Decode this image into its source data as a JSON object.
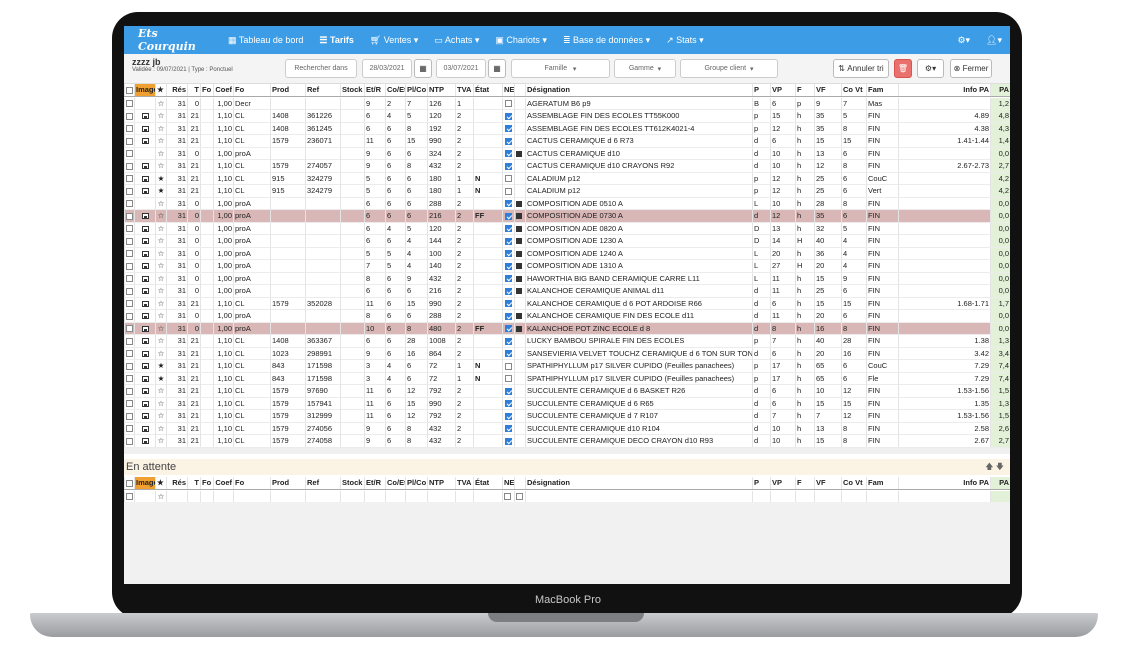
{
  "device_label": "MacBook Pro",
  "nav": {
    "brand": "Ets Courquin",
    "items": [
      "Tableau de bord",
      "Tarifs",
      "Ventes",
      "Achats",
      "Chariots",
      "Base de données",
      "Stats"
    ]
  },
  "toolbar": {
    "title": "zzzz jb",
    "subtitle": "Validée : 09/07/2021 | Type : Ponctuel",
    "search_placeholder": "Rechercher dans",
    "date_from": "28/03/2021",
    "date_to": "03/07/2021",
    "famille_placeholder": "Famille",
    "gamme_placeholder": "Gamme",
    "groupe_placeholder": "Groupe client",
    "annuler_tri": "Annuler tri",
    "fermer": "Fermer"
  },
  "columns": [
    "Ch",
    "Image",
    "★",
    "Rés",
    "T",
    "Fo",
    "Coef",
    "Fo",
    "Prod",
    "Ref",
    "Stock",
    "Et/R",
    "Co/Et",
    "Pl/Co",
    "NTP",
    "TVA",
    "État",
    "NE",
    "Co",
    "Désignation",
    "P",
    "VP",
    "F",
    "VF",
    "Co",
    "Vt",
    "Fam",
    "Info PA",
    "PA"
  ],
  "header_labels": {
    "img": "Image",
    "star": "★",
    "res": "Rés",
    "t": "T",
    "fo": "Fo",
    "coef": "Coef",
    "fo2": "Fo",
    "prod": "Prod",
    "ref": "Ref",
    "stock": "Stock",
    "etr": "Et/R",
    "coet": "Co/Et",
    "plco": "Pl/Co",
    "ntp": "NTP",
    "tva": "TVA",
    "etat": "État",
    "neco": "NECo",
    "des": "Désignation",
    "p": "P",
    "vp": "VP",
    "f": "F",
    "vf": "VF",
    "covt": "Co Vt",
    "fam": "Fam",
    "infopa": "Info PA",
    "pa": "PA"
  },
  "rows": [
    {
      "img": false,
      "star": false,
      "res": "31",
      "t": "0",
      "coef": "1,00",
      "fo": "Decr",
      "prod": "",
      "ref": "",
      "stock": "",
      "etr": "9",
      "coet": "2",
      "plco": "7",
      "ntp": "126",
      "tva": "1",
      "etat": "",
      "ne": false,
      "co": false,
      "des": "AGERATUM B6 p9",
      "p": "B",
      "vp": "6",
      "f": "p",
      "vf": "9",
      "covt": "7",
      "fam": "Mas",
      "info": "",
      "pa": "1,2",
      "pink": false
    },
    {
      "img": true,
      "star": false,
      "res": "31",
      "t": "21",
      "coef": "1,10",
      "fo": "CL",
      "prod": "1408",
      "ref": "361226",
      "stock": "",
      "etr": "6",
      "coet": "4",
      "plco": "5",
      "ntp": "120",
      "tva": "2",
      "etat": "",
      "ne": true,
      "co": false,
      "des": "ASSEMBLAGE FIN DES ECOLES TT55K000",
      "p": "p",
      "vp": "15",
      "f": "h",
      "vf": "35",
      "covt": "5",
      "fam": "FIN",
      "info": "4.89",
      "pa": "4,8",
      "pink": false
    },
    {
      "img": true,
      "star": false,
      "res": "31",
      "t": "21",
      "coef": "1,10",
      "fo": "CL",
      "prod": "1408",
      "ref": "361245",
      "stock": "",
      "etr": "6",
      "coet": "6",
      "plco": "8",
      "ntp": "192",
      "tva": "2",
      "etat": "",
      "ne": true,
      "co": false,
      "des": "ASSEMBLAGE FIN DES ECOLES TT612K4021-4",
      "p": "p",
      "vp": "12",
      "f": "h",
      "vf": "35",
      "covt": "8",
      "fam": "FIN",
      "info": "4.38",
      "pa": "4,3",
      "pink": false
    },
    {
      "img": true,
      "star": false,
      "res": "31",
      "t": "21",
      "coef": "1,10",
      "fo": "CL",
      "prod": "1579",
      "ref": "236071",
      "stock": "",
      "etr": "11",
      "coet": "6",
      "plco": "15",
      "ntp": "990",
      "tva": "2",
      "etat": "",
      "ne": true,
      "co": false,
      "des": "CACTUS CERAMIQUE d 6 R73",
      "p": "d",
      "vp": "6",
      "f": "h",
      "vf": "15",
      "covt": "15",
      "fam": "FIN",
      "info": "1.41-1.44",
      "pa": "1,4",
      "pink": false
    },
    {
      "img": false,
      "star": false,
      "res": "31",
      "t": "0",
      "coef": "1,00",
      "fo": "proA",
      "prod": "",
      "ref": "",
      "stock": "",
      "etr": "9",
      "coet": "6",
      "plco": "6",
      "ntp": "324",
      "tva": "2",
      "etat": "",
      "ne": true,
      "co": true,
      "des": "CACTUS CERAMIQUE d10",
      "p": "d",
      "vp": "10",
      "f": "h",
      "vf": "13",
      "covt": "6",
      "fam": "FIN",
      "info": "",
      "pa": "0,0",
      "pink": false
    },
    {
      "img": true,
      "star": false,
      "res": "31",
      "t": "21",
      "coef": "1,10",
      "fo": "CL",
      "prod": "1579",
      "ref": "274057",
      "stock": "",
      "etr": "9",
      "coet": "6",
      "plco": "8",
      "ntp": "432",
      "tva": "2",
      "etat": "",
      "ne": true,
      "co": false,
      "des": "CACTUS CERAMIQUE d10 CRAYONS R92",
      "p": "d",
      "vp": "10",
      "f": "h",
      "vf": "12",
      "covt": "8",
      "fam": "FIN",
      "info": "2.67-2.73",
      "pa": "2,7",
      "pink": false
    },
    {
      "img": true,
      "star": true,
      "res": "31",
      "t": "21",
      "coef": "1,10",
      "fo": "CL",
      "prod": "915",
      "ref": "324279",
      "stock": "",
      "etr": "5",
      "coet": "6",
      "plco": "6",
      "ntp": "180",
      "tva": "1",
      "etat": "N",
      "ne": false,
      "co": false,
      "des": "CALADIUM p12",
      "p": "p",
      "vp": "12",
      "f": "h",
      "vf": "25",
      "covt": "6",
      "fam": "CouC",
      "info": "",
      "pa": "4,2",
      "pink": false
    },
    {
      "img": true,
      "star": true,
      "res": "31",
      "t": "21",
      "coef": "1,10",
      "fo": "CL",
      "prod": "915",
      "ref": "324279",
      "stock": "",
      "etr": "5",
      "coet": "6",
      "plco": "6",
      "ntp": "180",
      "tva": "1",
      "etat": "N",
      "ne": false,
      "co": false,
      "des": "CALADIUM p12",
      "p": "p",
      "vp": "12",
      "f": "h",
      "vf": "25",
      "covt": "6",
      "fam": "Vert",
      "info": "",
      "pa": "4,2",
      "pink": false
    },
    {
      "img": false,
      "star": false,
      "res": "31",
      "t": "0",
      "coef": "1,00",
      "fo": "proA",
      "prod": "",
      "ref": "",
      "stock": "",
      "etr": "6",
      "coet": "6",
      "plco": "6",
      "ntp": "288",
      "tva": "2",
      "etat": "",
      "ne": true,
      "co": true,
      "des": "COMPOSITION ADE 0510 A",
      "p": "L",
      "vp": "10",
      "f": "h",
      "vf": "28",
      "covt": "8",
      "fam": "FIN",
      "info": "",
      "pa": "0,0",
      "pink": false
    },
    {
      "img": true,
      "star": false,
      "res": "31",
      "t": "0",
      "coef": "1,00",
      "fo": "proA",
      "prod": "",
      "ref": "",
      "stock": "",
      "etr": "6",
      "coet": "6",
      "plco": "6",
      "ntp": "216",
      "tva": "2",
      "etat": "FF",
      "ne": true,
      "co": true,
      "des": "COMPOSITION ADE 0730 A",
      "p": "d",
      "vp": "12",
      "f": "h",
      "vf": "35",
      "covt": "6",
      "fam": "FIN",
      "info": "",
      "pa": "0,0",
      "pink": true
    },
    {
      "img": true,
      "star": false,
      "res": "31",
      "t": "0",
      "coef": "1,00",
      "fo": "proA",
      "prod": "",
      "ref": "",
      "stock": "",
      "etr": "6",
      "coet": "4",
      "plco": "5",
      "ntp": "120",
      "tva": "2",
      "etat": "",
      "ne": true,
      "co": true,
      "des": "COMPOSITION ADE 0820 A",
      "p": "D",
      "vp": "13",
      "f": "h",
      "vf": "32",
      "covt": "5",
      "fam": "FIN",
      "info": "",
      "pa": "0,0",
      "pink": false
    },
    {
      "img": true,
      "star": false,
      "res": "31",
      "t": "0",
      "coef": "1,00",
      "fo": "proA",
      "prod": "",
      "ref": "",
      "stock": "",
      "etr": "6",
      "coet": "6",
      "plco": "4",
      "ntp": "144",
      "tva": "2",
      "etat": "",
      "ne": true,
      "co": true,
      "des": "COMPOSITION ADE 1230 A",
      "p": "D",
      "vp": "14",
      "f": "H",
      "vf": "40",
      "covt": "4",
      "fam": "FIN",
      "info": "",
      "pa": "0,0",
      "pink": false
    },
    {
      "img": true,
      "star": false,
      "res": "31",
      "t": "0",
      "coef": "1,00",
      "fo": "proA",
      "prod": "",
      "ref": "",
      "stock": "",
      "etr": "5",
      "coet": "5",
      "plco": "4",
      "ntp": "100",
      "tva": "2",
      "etat": "",
      "ne": true,
      "co": true,
      "des": "COMPOSITION ADE 1240 A",
      "p": "L",
      "vp": "20",
      "f": "h",
      "vf": "36",
      "covt": "4",
      "fam": "FIN",
      "info": "",
      "pa": "0,0",
      "pink": false
    },
    {
      "img": true,
      "star": false,
      "res": "31",
      "t": "0",
      "coef": "1,00",
      "fo": "proA",
      "prod": "",
      "ref": "",
      "stock": "",
      "etr": "7",
      "coet": "5",
      "plco": "4",
      "ntp": "140",
      "tva": "2",
      "etat": "",
      "ne": true,
      "co": true,
      "des": "COMPOSITION ADE 1310 A",
      "p": "L",
      "vp": "27",
      "f": "H",
      "vf": "20",
      "covt": "4",
      "fam": "FIN",
      "info": "",
      "pa": "0,0",
      "pink": false
    },
    {
      "img": true,
      "star": false,
      "res": "31",
      "t": "0",
      "coef": "1,00",
      "fo": "proA",
      "prod": "",
      "ref": "",
      "stock": "",
      "etr": "8",
      "coet": "6",
      "plco": "9",
      "ntp": "432",
      "tva": "2",
      "etat": "",
      "ne": true,
      "co": true,
      "des": "HAWORTHIA BIG BAND CERAMIQUE CARRE L11",
      "p": "L",
      "vp": "11",
      "f": "h",
      "vf": "15",
      "covt": "9",
      "fam": "FIN",
      "info": "",
      "pa": "0,0",
      "pink": false
    },
    {
      "img": true,
      "star": false,
      "res": "31",
      "t": "0",
      "coef": "1,00",
      "fo": "proA",
      "prod": "",
      "ref": "",
      "stock": "",
      "etr": "6",
      "coet": "6",
      "plco": "6",
      "ntp": "216",
      "tva": "2",
      "etat": "",
      "ne": true,
      "co": true,
      "des": "KALANCHOE CERAMIQUE ANIMAL d11",
      "p": "d",
      "vp": "11",
      "f": "h",
      "vf": "25",
      "covt": "6",
      "fam": "FIN",
      "info": "",
      "pa": "0,0",
      "pink": false
    },
    {
      "img": true,
      "star": false,
      "res": "31",
      "t": "21",
      "coef": "1,10",
      "fo": "CL",
      "prod": "1579",
      "ref": "352028",
      "stock": "",
      "etr": "11",
      "coet": "6",
      "plco": "15",
      "ntp": "990",
      "tva": "2",
      "etat": "",
      "ne": true,
      "co": false,
      "des": "KALANCHOE CERAMIQUE d 6 POT ARDOISE R66",
      "p": "d",
      "vp": "6",
      "f": "h",
      "vf": "15",
      "covt": "15",
      "fam": "FIN",
      "info": "1.68-1.71",
      "pa": "1,7",
      "pink": false
    },
    {
      "img": true,
      "star": false,
      "res": "31",
      "t": "0",
      "coef": "1,00",
      "fo": "proA",
      "prod": "",
      "ref": "",
      "stock": "",
      "etr": "8",
      "coet": "6",
      "plco": "6",
      "ntp": "288",
      "tva": "2",
      "etat": "",
      "ne": true,
      "co": true,
      "des": "KALANCHOE CERAMIQUE FIN DES ECOLE d11",
      "p": "d",
      "vp": "11",
      "f": "h",
      "vf": "20",
      "covt": "6",
      "fam": "FIN",
      "info": "",
      "pa": "0,0",
      "pink": false
    },
    {
      "img": true,
      "star": false,
      "res": "31",
      "t": "0",
      "coef": "1,00",
      "fo": "proA",
      "prod": "",
      "ref": "",
      "stock": "",
      "etr": "10",
      "coet": "6",
      "plco": "8",
      "ntp": "480",
      "tva": "2",
      "etat": "FF",
      "ne": true,
      "co": true,
      "des": "KALANCHOE POT ZINC ECOLE d 8",
      "p": "d",
      "vp": "8",
      "f": "h",
      "vf": "16",
      "covt": "8",
      "fam": "FIN",
      "info": "",
      "pa": "0,0",
      "pink": true
    },
    {
      "img": true,
      "star": false,
      "res": "31",
      "t": "21",
      "coef": "1,10",
      "fo": "CL",
      "prod": "1408",
      "ref": "363367",
      "stock": "",
      "etr": "6",
      "coet": "6",
      "plco": "28",
      "ntp": "1008",
      "tva": "2",
      "etat": "",
      "ne": true,
      "co": false,
      "des": "LUCKY BAMBOU SPIRALE FIN DES ECOLES",
      "p": "p",
      "vp": "7",
      "f": "h",
      "vf": "40",
      "covt": "28",
      "fam": "FIN",
      "info": "1.38",
      "pa": "1,3",
      "pink": false
    },
    {
      "img": true,
      "star": false,
      "res": "31",
      "t": "21",
      "coef": "1,10",
      "fo": "CL",
      "prod": "1023",
      "ref": "298991",
      "stock": "",
      "etr": "9",
      "coet": "6",
      "plco": "16",
      "ntp": "864",
      "tva": "2",
      "etat": "",
      "ne": true,
      "co": false,
      "des": "SANSEVIERIA VELVET TOUCHZ CERAMIQUE d 6 TON SUR TON",
      "p": "d",
      "vp": "6",
      "f": "h",
      "vf": "20",
      "covt": "16",
      "fam": "FIN",
      "info": "3.42",
      "pa": "3,4",
      "pink": false
    },
    {
      "img": true,
      "star": true,
      "res": "31",
      "t": "21",
      "coef": "1,10",
      "fo": "CL",
      "prod": "843",
      "ref": "171598",
      "stock": "",
      "etr": "3",
      "coet": "4",
      "plco": "6",
      "ntp": "72",
      "tva": "1",
      "etat": "N",
      "ne": false,
      "co": false,
      "des": "SPATHIPHYLLUM p17 SILVER CUPIDO (Feuilles panachees)",
      "p": "p",
      "vp": "17",
      "f": "h",
      "vf": "65",
      "covt": "6",
      "fam": "CouC",
      "info": "7.29",
      "pa": "7,4",
      "pink": false
    },
    {
      "img": true,
      "star": true,
      "res": "31",
      "t": "21",
      "coef": "1,10",
      "fo": "CL",
      "prod": "843",
      "ref": "171598",
      "stock": "",
      "etr": "3",
      "coet": "4",
      "plco": "6",
      "ntp": "72",
      "tva": "1",
      "etat": "N",
      "ne": false,
      "co": false,
      "des": "SPATHIPHYLLUM p17 SILVER CUPIDO (Feuilles panachees)",
      "p": "p",
      "vp": "17",
      "f": "h",
      "vf": "65",
      "covt": "6",
      "fam": "Fle",
      "info": "7.29",
      "pa": "7,4",
      "pink": false
    },
    {
      "img": true,
      "star": false,
      "res": "31",
      "t": "21",
      "coef": "1,10",
      "fo": "CL",
      "prod": "1579",
      "ref": "97690",
      "stock": "",
      "etr": "11",
      "coet": "6",
      "plco": "12",
      "ntp": "792",
      "tva": "2",
      "etat": "",
      "ne": true,
      "co": false,
      "des": "SUCCULENTE CERAMIQUE d 6 BASKET R26",
      "p": "d",
      "vp": "6",
      "f": "h",
      "vf": "10",
      "covt": "12",
      "fam": "FIN",
      "info": "1.53-1.56",
      "pa": "1,5",
      "pink": false
    },
    {
      "img": true,
      "star": false,
      "res": "31",
      "t": "21",
      "coef": "1,10",
      "fo": "CL",
      "prod": "1579",
      "ref": "157941",
      "stock": "",
      "etr": "11",
      "coet": "6",
      "plco": "15",
      "ntp": "990",
      "tva": "2",
      "etat": "",
      "ne": true,
      "co": false,
      "des": "SUCCULENTE CERAMIQUE d 6 R65",
      "p": "d",
      "vp": "6",
      "f": "h",
      "vf": "15",
      "covt": "15",
      "fam": "FIN",
      "info": "1.35",
      "pa": "1,3",
      "pink": false
    },
    {
      "img": true,
      "star": false,
      "res": "31",
      "t": "21",
      "coef": "1,10",
      "fo": "CL",
      "prod": "1579",
      "ref": "312999",
      "stock": "",
      "etr": "11",
      "coet": "6",
      "plco": "12",
      "ntp": "792",
      "tva": "2",
      "etat": "",
      "ne": true,
      "co": false,
      "des": "SUCCULENTE CERAMIQUE d 7 R107",
      "p": "d",
      "vp": "7",
      "f": "h",
      "vf": "7",
      "covt": "12",
      "fam": "FIN",
      "info": "1.53-1.56",
      "pa": "1,5",
      "pink": false
    },
    {
      "img": true,
      "star": false,
      "res": "31",
      "t": "21",
      "coef": "1,10",
      "fo": "CL",
      "prod": "1579",
      "ref": "274056",
      "stock": "",
      "etr": "9",
      "coet": "6",
      "plco": "8",
      "ntp": "432",
      "tva": "2",
      "etat": "",
      "ne": true,
      "co": false,
      "des": "SUCCULENTE CERAMIQUE d10 R104",
      "p": "d",
      "vp": "10",
      "f": "h",
      "vf": "13",
      "covt": "8",
      "fam": "FIN",
      "info": "2.58",
      "pa": "2,6",
      "pink": false
    },
    {
      "img": true,
      "star": false,
      "res": "31",
      "t": "21",
      "coef": "1,10",
      "fo": "CL",
      "prod": "1579",
      "ref": "274058",
      "stock": "",
      "etr": "9",
      "coet": "6",
      "plco": "8",
      "ntp": "432",
      "tva": "2",
      "etat": "",
      "ne": true,
      "co": false,
      "des": "SUCCULENTE CERAMIQUE DECO CRAYON d10 R93",
      "p": "d",
      "vp": "10",
      "f": "h",
      "vf": "15",
      "covt": "8",
      "fam": "FIN",
      "info": "2.67",
      "pa": "2,7",
      "pink": false
    }
  ],
  "waiting": {
    "title": "En attente"
  }
}
